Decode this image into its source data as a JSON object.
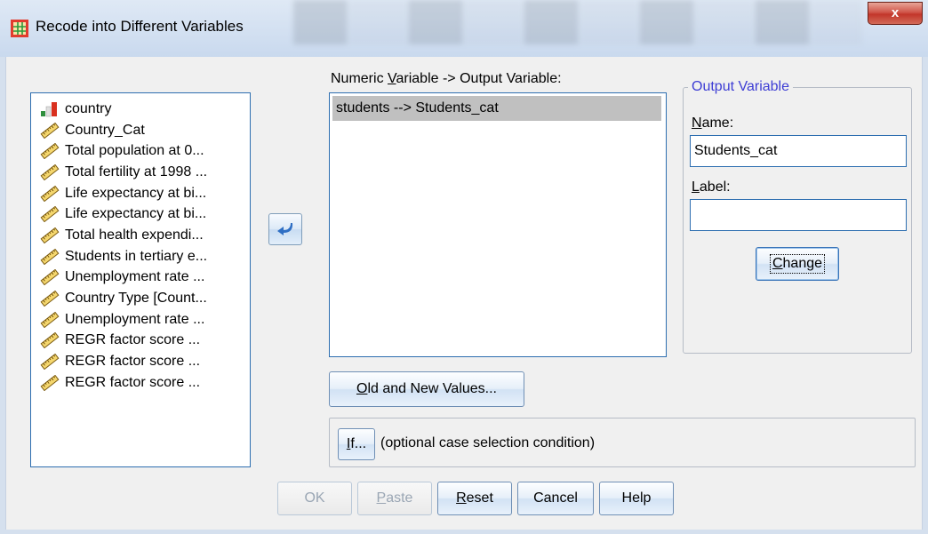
{
  "window": {
    "title": "Recode into Different Variables",
    "close_glyph": "x"
  },
  "source_list": {
    "items": [
      {
        "label": "country",
        "icon": "nominal-bar-icon"
      },
      {
        "label": "Country_Cat",
        "icon": "ruler-scale-icon"
      },
      {
        "label": "Total population at 0...",
        "icon": "ruler-scale-icon"
      },
      {
        "label": "Total fertility at 1998 ...",
        "icon": "ruler-scale-icon"
      },
      {
        "label": "Life expectancy at bi...",
        "icon": "ruler-scale-icon"
      },
      {
        "label": "Life expectancy at bi...",
        "icon": "ruler-scale-icon"
      },
      {
        "label": "Total health expendi...",
        "icon": "ruler-scale-icon"
      },
      {
        "label": "Students in tertiary e...",
        "icon": "ruler-scale-icon"
      },
      {
        "label": "Unemployment rate ...",
        "icon": "ruler-scale-icon"
      },
      {
        "label": "Country Type [Count...",
        "icon": "ruler-scale-icon"
      },
      {
        "label": "Unemployment rate ...",
        "icon": "ruler-scale-icon"
      },
      {
        "label": "REGR factor score  ...",
        "icon": "ruler-scale-icon"
      },
      {
        "label": "REGR factor score  ...",
        "icon": "ruler-scale-icon"
      },
      {
        "label": "REGR factor score  ...",
        "icon": "ruler-scale-icon"
      }
    ]
  },
  "mapping": {
    "label_pre": "Numeric ",
    "label_accel": "V",
    "label_post": "ariable -> Output Variable:",
    "items": [
      "students --> Students_cat"
    ]
  },
  "output_variable": {
    "legend": "Output Variable",
    "name_label_accel": "N",
    "name_label_rest": "ame:",
    "name_value": "Students_cat",
    "label_label_accel": "L",
    "label_label_rest": "abel:",
    "label_value": "",
    "change_accel": "C",
    "change_rest": "hange"
  },
  "old_new": {
    "accel": "O",
    "rest": "ld and New Values..."
  },
  "if": {
    "accel": "I",
    "rest": "f...",
    "description": "(optional case selection condition)"
  },
  "buttons": {
    "ok": "OK",
    "paste_accel": "P",
    "paste_rest": "aste",
    "reset_accel": "R",
    "reset_rest": "eset",
    "cancel": "Cancel",
    "help": "Help"
  },
  "colors": {
    "list_border": "#2d6eb0",
    "selection": "#c0c0c0",
    "legend": "#3d3dd4",
    "close_red": "#c2362a"
  }
}
